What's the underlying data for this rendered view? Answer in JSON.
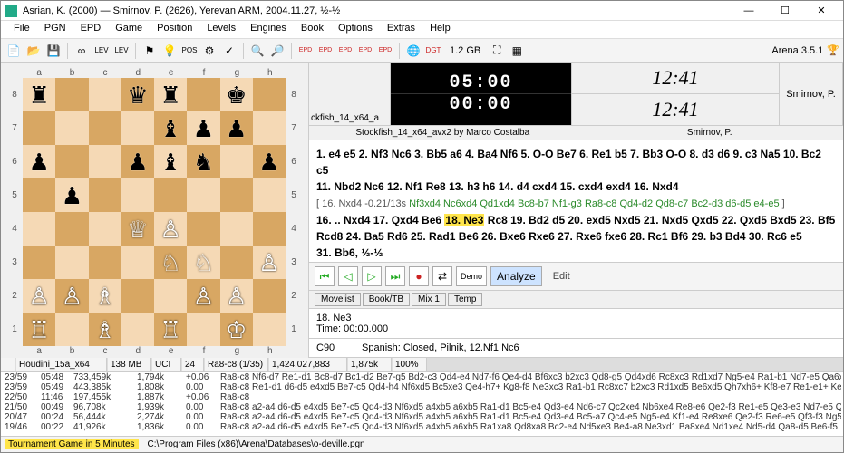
{
  "title": "Asrian, K. (2000) — Smirnov, P. (2626),  Yerevan ARM,  2004.11.27,  ½-½",
  "menus": [
    "File",
    "PGN",
    "EPD",
    "Game",
    "Position",
    "Levels",
    "Engines",
    "Book",
    "Options",
    "Extras",
    "Help"
  ],
  "memory": "1.2 GB",
  "app_label": "Arena 3.5.1",
  "engine_left_label": "ckfish_14_x64_a",
  "clock_top": "05:00",
  "clock_bottom": "00:00",
  "engine_credit": "Stockfish_14_x64_avx2 by Marco Costalba",
  "right_clock_top": "12:41",
  "right_clock_bottom": "12:41",
  "player_name": "Smirnov, P.",
  "player_name2": "Smirnov, P.",
  "moves_bold1": "1. e4 e5 2. Nf3 Nc6 3. Bb5 a6 4. Ba4 Nf6 5. O-O Be7 6. Re1 b5 7. Bb3 O-O 8. d3 d6 9. c3 Na5 10. Bc2 c5",
  "moves_bold2": "11. Nbd2 Nc6 12. Nf1 Re8 13. h3 h6 14. d4 cxd4 15. cxd4 exd4 16. Nxd4",
  "info_line": "  [ 16. Nxd4  -0.21/13s",
  "info_green": " Nf3xd4 Nc6xd4 Qd1xd4 Bc8-b7 Nf1-g3 Ra8-c8 Qd4-d2 Qd8-c7 Bc2-d3 d6-d5 e4-e5",
  "info_close": " ]",
  "moves_bold3a": "16. .. Nxd4 17. Qxd4 Be6 ",
  "hilite_move": "18. Ne3",
  "moves_bold3b": " Rc8 19. Bd2 d5 20. exd5 Nxd5 21. Nxd5 Qxd5 22. Qxd5 Bxd5 23. Bf5",
  "moves_bold4": "Rcd8 24. Ba5 Rd6 25. Rad1 Be6 26. Bxe6 Rxe6 27. Rxe6 fxe6 28. Rc1 Bf6 29. b3 Bd4 30. Rc6 e5",
  "moves_bold5": "31. Bb6, ½-½",
  "nav_demo": "Demo",
  "nav_analyze": "Analyze",
  "edit_label": "Edit",
  "tabs": [
    "Movelist",
    "Book/TB",
    "Mix 1",
    "Temp"
  ],
  "cur_move": "18. Ne3",
  "cur_time": "Time: 00:00.000",
  "eco": "C90",
  "opening_name": "Spanish: Closed, Pilnik, 12.Nf1 Nc6",
  "ah": {
    "engine": "Houdini_15a_x64",
    "mem": "138 MB",
    "proto": "UCI",
    "depth": "24",
    "move": "Ra8-c8 (1/35)",
    "nodes": "1,424,027,883",
    "nps": "1,875k",
    "hash": "100%"
  },
  "analysis": [
    {
      "d": "23/59",
      "t": "05:48",
      "n": "733,459k",
      "nps": "1,794k",
      "s": "+0.06",
      "m": "Ra8-c8",
      "pv": "Nf6-d7 Re1-d1 Bc8-d7 Bc1-d2 Be7-g5 Bd2-c3 Qd4-e4 Nd7-f6 Qe4-d4 Bf6xc3 b2xc3 Qd8-g5 Qd4xd6 Rc8xc3 Rd1xd7 Ng5-e4 Ra1-b1 Nd7-e5 Qa6xb5 Rc8xb5 Qb5-e2 Nb5xc3 Qe2-e5 Bc2-d3 Bh3-g4"
    },
    {
      "d": "23/59",
      "t": "05:49",
      "n": "443,385k",
      "nps": "1,808k",
      "s": "0.00",
      "m": "Ra8-c8",
      "pv": "Re1-d1 d6-d5 e4xd5 Be7-c5 Qd4-h4 Nf6xd5 Bc5xe3 Qe4-h7+ Kg8-f8 Ne3xc3 Ra1-b1 Rc8xc7 b2xc3 Rd1xd5 Be6xd5 Qh7xh6+ Kf8-e7 Re1-e1+ Ke7-"
    },
    {
      "d": "22/50",
      "t": "11:46",
      "n": "197,455k",
      "nps": "1,887k",
      "s": "+0.06",
      "m": "Ra8-c8",
      "pv": ""
    },
    {
      "d": "21/50",
      "t": "00:49",
      "n": "96,708k",
      "nps": "1,939k",
      "s": "0.00",
      "m": "Ra8-c8",
      "pv": "a2-a4 d6-d5 e4xd5 Be7-c5 Qd4-d3 Nf6xd5 a4xb5 a6xb5 Ra1-d1 Bc5-e4 Qd3-e4 Nd6-c7 Qc2xe4 Nb6xe4 Re8-e6 Qe2-f3 Re1-e5 Qe3-e3 Nd7-e5 Qc5-f3 Qf3-"
    },
    {
      "d": "20/47",
      "t": "00:24",
      "n": "56,444k",
      "nps": "2,274k",
      "s": "0.00",
      "m": "Ra8-c8",
      "pv": "a2-a4 d6-d5 e4xd5 Be7-c5 Qd4-d3 Nf6xd5 a4xb5 a6xb5 Ra1-d1 Bc5-e4 Qd3-e4 Bc5-a7 Qc4-e5 Ng5-e4 Kf1-e4 Re8xe6 Qe2-f3 Re6-e5 Qf3-f3 Ng5-e5 Qf5-f6-"
    },
    {
      "d": "19/46",
      "t": "00:22",
      "n": "41,926k",
      "nps": "1,836k",
      "s": "0.00",
      "m": "Ra8-c8",
      "pv": "a2-a4 d6-d5 e4xd5 Be7-c5 Qd4-d3 Nf6xd5 a4xb5 a6xb5 Ra1xa8 Qd8xa8 Bc2-e4 Nd5xe3 Be4-a8 Ne3xd1 Ba8xe4 Nd1xe4 Nd5-d4 Qa8-d5 Be6-f5"
    }
  ],
  "status1": "Tournament Game in 5 Minutes",
  "status2": "C:\\Program Files (x86)\\Arena\\Databases\\o-deville.pgn",
  "files": [
    "a",
    "b",
    "c",
    "d",
    "e",
    "f",
    "g",
    "h"
  ],
  "ranks": [
    "8",
    "7",
    "6",
    "5",
    "4",
    "3",
    "2",
    "1"
  ],
  "chart_data": {
    "type": "table",
    "board_fen_like": "r1bqr1k1/4bpp1/p2pbn1p/1p6/3QP3/4NN1P/PPB2PP1/R1B1R1K1 w",
    "pieces": [
      {
        "sq": "a8",
        "p": "r"
      },
      {
        "sq": "d8",
        "p": "q"
      },
      {
        "sq": "e8",
        "p": "r"
      },
      {
        "sq": "g8",
        "p": "k"
      },
      {
        "sq": "e7",
        "p": "b"
      },
      {
        "sq": "f7",
        "p": "p"
      },
      {
        "sq": "g7",
        "p": "p"
      },
      {
        "sq": "a6",
        "p": "p"
      },
      {
        "sq": "d6",
        "p": "p"
      },
      {
        "sq": "e6",
        "p": "b"
      },
      {
        "sq": "f6",
        "p": "n"
      },
      {
        "sq": "h6",
        "p": "p"
      },
      {
        "sq": "b5",
        "p": "p"
      },
      {
        "sq": "d4",
        "p": "Q"
      },
      {
        "sq": "e4",
        "p": "P"
      },
      {
        "sq": "e3",
        "p": "N"
      },
      {
        "sq": "f3",
        "p": "N"
      },
      {
        "sq": "h3",
        "p": "P"
      },
      {
        "sq": "a2",
        "p": "P"
      },
      {
        "sq": "b2",
        "p": "P"
      },
      {
        "sq": "c2",
        "p": "B"
      },
      {
        "sq": "f2",
        "p": "P"
      },
      {
        "sq": "g2",
        "p": "P"
      },
      {
        "sq": "a1",
        "p": "R"
      },
      {
        "sq": "c1",
        "p": "B"
      },
      {
        "sq": "e1",
        "p": "R"
      },
      {
        "sq": "g1",
        "p": "K"
      }
    ]
  }
}
